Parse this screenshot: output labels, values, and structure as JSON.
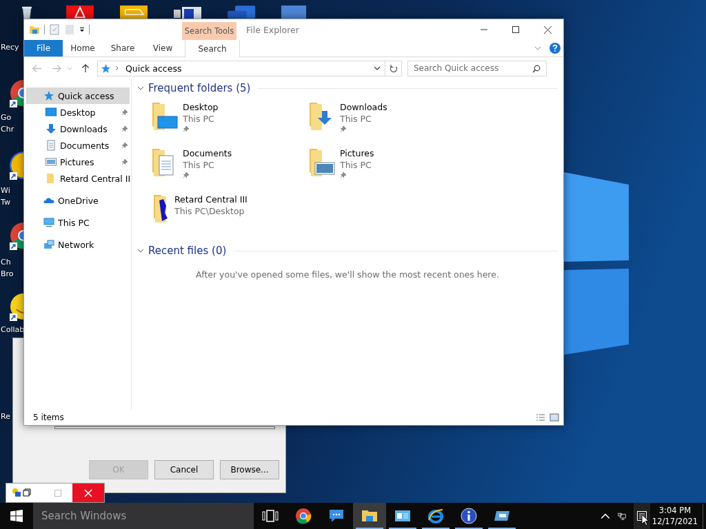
{
  "desktop_icons": [
    {
      "kind": "recycle",
      "lines": [
        "Recy"
      ]
    },
    {
      "kind": "chrome",
      "lines": [
        "Go",
        "Chr"
      ]
    },
    {
      "kind": "twitch",
      "lines": [
        "Wi",
        "Tw"
      ]
    },
    {
      "kind": "chrome",
      "lines": [
        "Ch",
        "Bro"
      ]
    },
    {
      "kind": "smiley",
      "lines": [
        "Collab"
      ]
    },
    {
      "kind": "blank",
      "lines": [
        "Re"
      ]
    }
  ],
  "explorer": {
    "title": "File Explorer",
    "contextual_group": "Search Tools",
    "ribbon_tabs": [
      {
        "label": "File",
        "kind": "file",
        "selected": false
      },
      {
        "label": "Home",
        "kind": "tab",
        "selected": false
      },
      {
        "label": "Share",
        "kind": "tab",
        "selected": false
      },
      {
        "label": "View",
        "kind": "tab",
        "selected": false
      },
      {
        "label": "Search",
        "kind": "contextual",
        "selected": true
      }
    ],
    "address": {
      "path": "Quick access"
    },
    "search": {
      "placeholder": "Search Quick access"
    },
    "nav_pane": [
      {
        "label": "Quick access",
        "selected": true,
        "children": [
          {
            "label": "Desktop",
            "pinned": true
          },
          {
            "label": "Downloads",
            "pinned": true
          },
          {
            "label": "Documents",
            "pinned": true
          },
          {
            "label": "Pictures",
            "pinned": true
          },
          {
            "label": "Retard Central II",
            "pinned": false
          }
        ]
      },
      {
        "label": "OneDrive",
        "selected": false
      },
      {
        "label": "This PC",
        "selected": false
      },
      {
        "label": "Network",
        "selected": false
      }
    ],
    "sections": [
      {
        "title": "Frequent folders (5)",
        "expanded": true,
        "folders": [
          {
            "name": "Desktop",
            "location": "This PC",
            "pinned": true
          },
          {
            "name": "Downloads",
            "location": "This PC",
            "pinned": true
          },
          {
            "name": "Documents",
            "location": "This PC",
            "pinned": true
          },
          {
            "name": "Pictures",
            "location": "This PC",
            "pinned": true
          },
          {
            "name": "Retard Central III",
            "location": "This PC\\Desktop",
            "pinned": false
          }
        ]
      },
      {
        "title": "Recent files (0)",
        "expanded": true,
        "message": "After you've opened some files, we'll show the most recent ones here."
      }
    ],
    "status": "5 items"
  },
  "dialog": {
    "buttons": [
      {
        "label": "OK",
        "disabled": true
      },
      {
        "label": "Cancel",
        "disabled": false
      },
      {
        "label": "Browse...",
        "disabled": false
      }
    ]
  },
  "taskbar": {
    "search": {
      "placeholder": "Search Windows"
    },
    "apps": [
      {
        "kind": "taskview",
        "active": false,
        "running": false
      },
      {
        "kind": "chrome",
        "active": false,
        "running": false
      },
      {
        "kind": "chat",
        "active": false,
        "running": false
      },
      {
        "kind": "explorer",
        "active": true,
        "running": true
      },
      {
        "kind": "panel",
        "active": false,
        "running": true
      },
      {
        "kind": "ie",
        "active": false,
        "running": true
      },
      {
        "kind": "info",
        "active": false,
        "running": true
      },
      {
        "kind": "remote",
        "active": false,
        "running": true
      }
    ],
    "clock": {
      "time": "3:04 PM",
      "date": "12/17/2021"
    }
  }
}
